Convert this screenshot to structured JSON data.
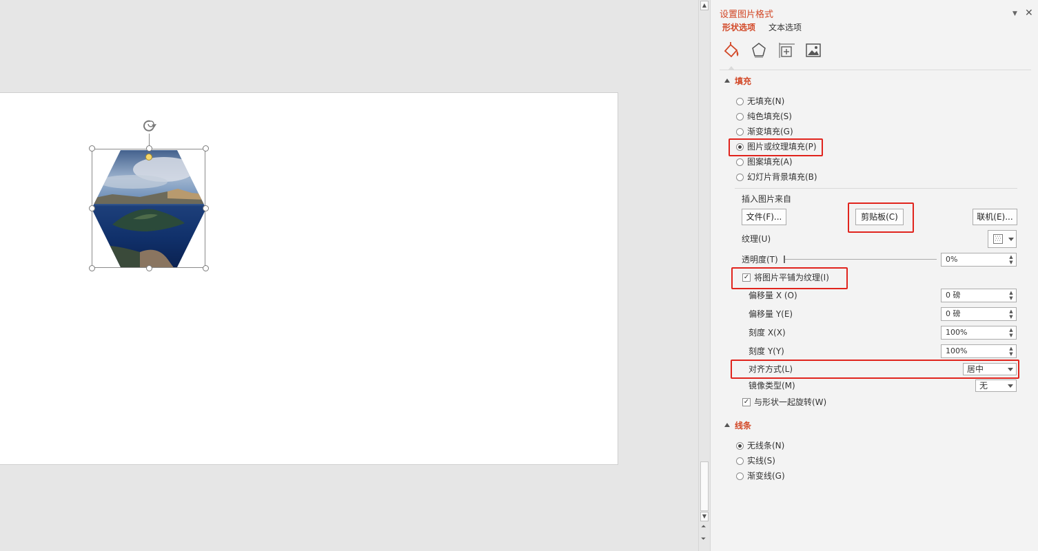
{
  "pane": {
    "title": "设置图片格式",
    "tabs": [
      {
        "label": "形状选项",
        "active": true
      },
      {
        "label": "文本选项",
        "active": false
      }
    ],
    "icon_tabs": [
      "fill-line-icon",
      "effects-pentagon-icon",
      "size-properties-icon",
      "picture-icon"
    ],
    "fill": {
      "section_title": "填充",
      "options": [
        {
          "label": "无填充(N)",
          "selected": false
        },
        {
          "label": "纯色填充(S)",
          "selected": false
        },
        {
          "label": "渐变填充(G)",
          "selected": false
        },
        {
          "label": "图片或纹理填充(P)",
          "selected": true
        },
        {
          "label": "图案填充(A)",
          "selected": false
        },
        {
          "label": "幻灯片背景填充(B)",
          "selected": false
        }
      ],
      "insert_from_label": "插入图片来自",
      "file_button": "文件(F)...",
      "clipboard_button": "剪贴板(C)",
      "online_button": "联机(E)...",
      "texture_label": "纹理(U)",
      "transparency_label": "透明度(T)",
      "transparency_value": "0%",
      "transparency_fraction": 0,
      "tile_checkbox": {
        "label": "将图片平铺为纹理(I)",
        "checked": true
      },
      "offset_x": {
        "label": "偏移量 X (O)",
        "value": "0 磅"
      },
      "offset_y": {
        "label": "偏移量 Y(E)",
        "value": "0 磅"
      },
      "scale_x": {
        "label": "刻度 X(X)",
        "value": "100%"
      },
      "scale_y": {
        "label": "刻度 Y(Y)",
        "value": "100%"
      },
      "alignment": {
        "label": "对齐方式(L)",
        "value": "居中"
      },
      "mirror": {
        "label": "镜像类型(M)",
        "value": "无"
      },
      "rotate_with_shape": {
        "label": "与形状一起旋转(W)",
        "checked": true
      }
    },
    "line": {
      "section_title": "线条",
      "options": [
        {
          "label": "无线条(N)",
          "selected": true
        },
        {
          "label": "实线(S)",
          "selected": false
        },
        {
          "label": "渐变线(G)",
          "selected": false
        }
      ]
    }
  },
  "colors": {
    "accent": "#d24726",
    "highlight": "#e0231c",
    "pane_bg": "#f3f3f3",
    "editor_bg": "#e6e6e6"
  }
}
